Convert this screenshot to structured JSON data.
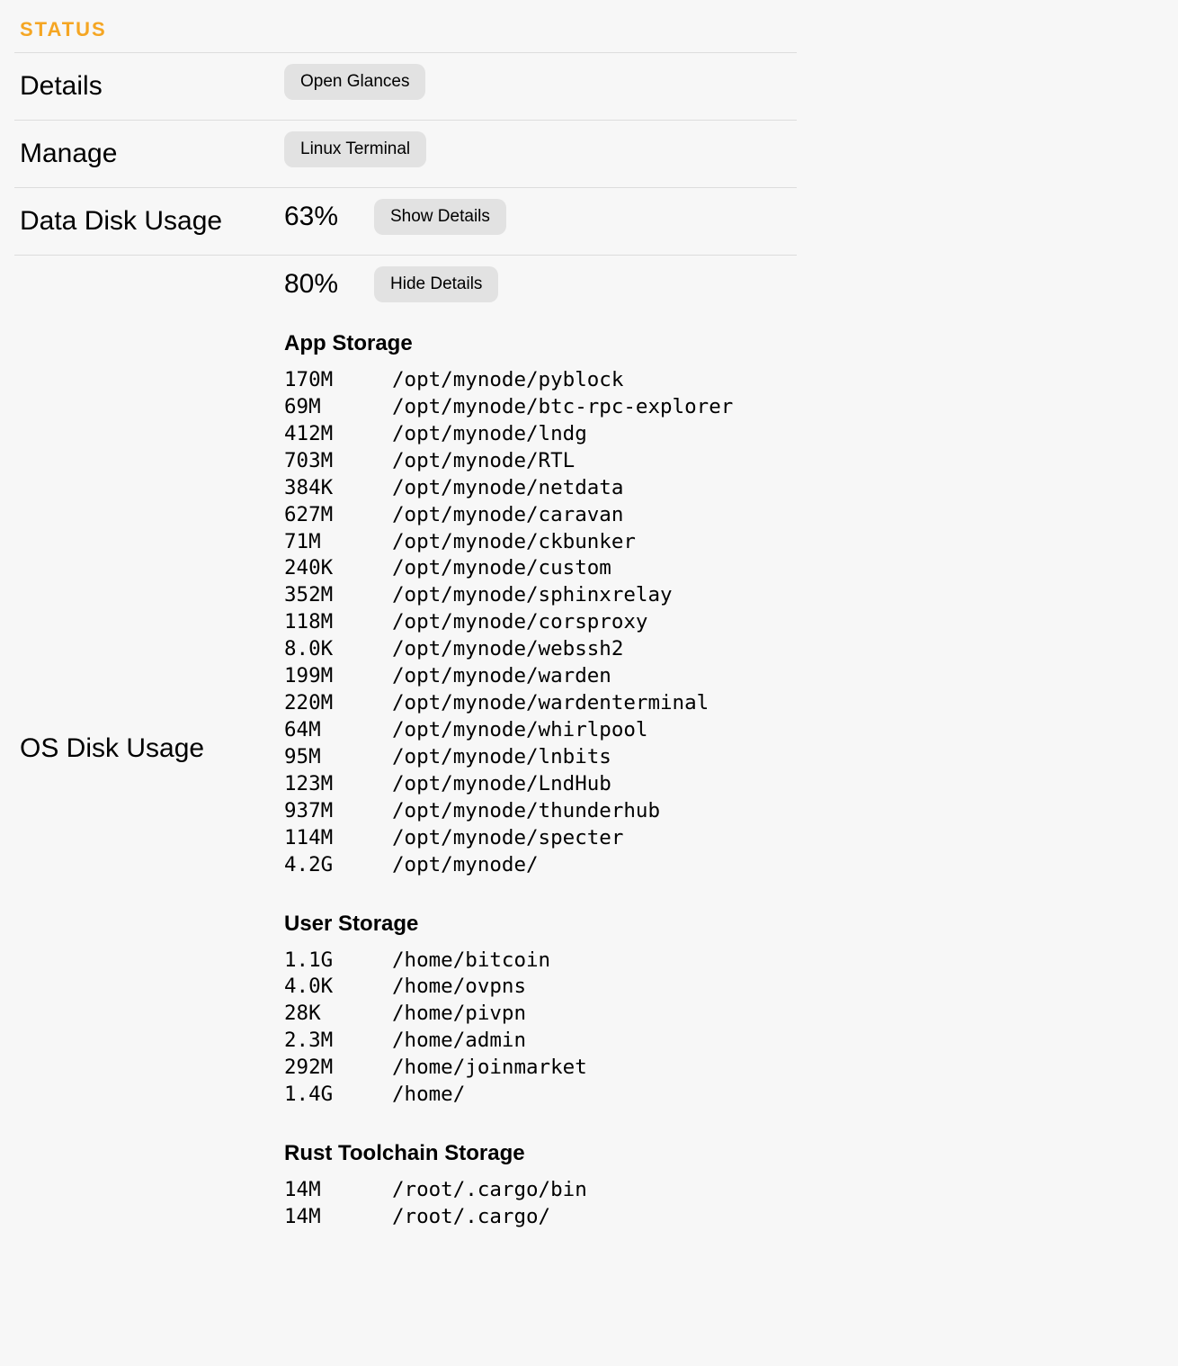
{
  "section_title": "STATUS",
  "rows": {
    "details": {
      "label": "Details",
      "button": "Open Glances"
    },
    "manage": {
      "label": "Manage",
      "button": "Linux Terminal"
    },
    "data_disk": {
      "label": "Data Disk Usage",
      "percent": "63%",
      "button": "Show Details"
    },
    "os_disk": {
      "label": "OS Disk Usage",
      "percent": "80%",
      "button": "Hide Details",
      "app_storage": {
        "heading": "App Storage",
        "items": [
          {
            "size": "170M",
            "path": "/opt/mynode/pyblock"
          },
          {
            "size": "69M",
            "path": "/opt/mynode/btc-rpc-explorer"
          },
          {
            "size": "412M",
            "path": "/opt/mynode/lndg"
          },
          {
            "size": "703M",
            "path": "/opt/mynode/RTL"
          },
          {
            "size": "384K",
            "path": "/opt/mynode/netdata"
          },
          {
            "size": "627M",
            "path": "/opt/mynode/caravan"
          },
          {
            "size": "71M",
            "path": "/opt/mynode/ckbunker"
          },
          {
            "size": "240K",
            "path": "/opt/mynode/custom"
          },
          {
            "size": "352M",
            "path": "/opt/mynode/sphinxrelay"
          },
          {
            "size": "118M",
            "path": "/opt/mynode/corsproxy"
          },
          {
            "size": "8.0K",
            "path": "/opt/mynode/webssh2"
          },
          {
            "size": "199M",
            "path": "/opt/mynode/warden"
          },
          {
            "size": "220M",
            "path": "/opt/mynode/wardenterminal"
          },
          {
            "size": "64M",
            "path": "/opt/mynode/whirlpool"
          },
          {
            "size": "95M",
            "path": "/opt/mynode/lnbits"
          },
          {
            "size": "123M",
            "path": "/opt/mynode/LndHub"
          },
          {
            "size": "937M",
            "path": "/opt/mynode/thunderhub"
          },
          {
            "size": "114M",
            "path": "/opt/mynode/specter"
          },
          {
            "size": "4.2G",
            "path": "/opt/mynode/"
          }
        ]
      },
      "user_storage": {
        "heading": "User Storage",
        "items": [
          {
            "size": "1.1G",
            "path": "/home/bitcoin"
          },
          {
            "size": "4.0K",
            "path": "/home/ovpns"
          },
          {
            "size": "28K",
            "path": "/home/pivpn"
          },
          {
            "size": "2.3M",
            "path": "/home/admin"
          },
          {
            "size": "292M",
            "path": "/home/joinmarket"
          },
          {
            "size": "1.4G",
            "path": "/home/"
          }
        ]
      },
      "rust_storage": {
        "heading": "Rust Toolchain Storage",
        "items": [
          {
            "size": "14M",
            "path": "/root/.cargo/bin"
          },
          {
            "size": "14M",
            "path": "/root/.cargo/"
          }
        ]
      }
    }
  }
}
